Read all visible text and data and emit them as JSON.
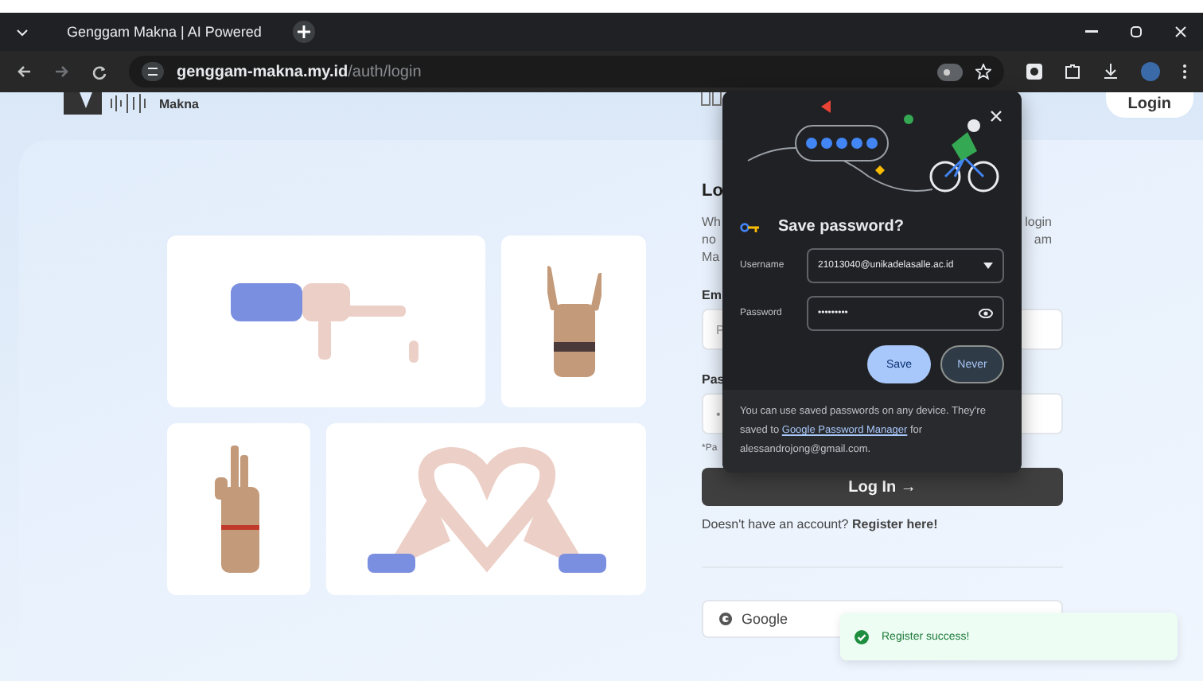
{
  "browser": {
    "tab": {
      "title": "Genggam Makna | AI Powered",
      "selected": true
    },
    "url_host": "genggam-makna.my.id",
    "url_path": "/auth/login"
  },
  "header": {
    "brand": "Makna",
    "login_button": "Login"
  },
  "gallery": [
    {
      "kind": "frame"
    },
    {
      "kind": "horns"
    },
    {
      "kind": "peace"
    },
    {
      "kind": "heart"
    }
  ],
  "form": {
    "title": "Lo",
    "description_left": [
      "Wh",
      "no",
      "Ma"
    ],
    "description_right": [
      "login",
      "am"
    ],
    "email_label": "Em",
    "email_placeholder": "P",
    "password_label": "Pas",
    "password_value": "•",
    "hint": "*Pa",
    "login_button": "Log In →",
    "register_prompt": "Doesn't have an account? **Register here!**",
    "google_button": "Google"
  },
  "password_dialog": {
    "title": "Save password?",
    "username_label": "Username",
    "username": "21013040@unikadelasalle.ac.id",
    "password_label": "Password",
    "password": "•••••••••",
    "save_button": "Save",
    "never_button": "Never",
    "footer_before": "You can use saved passwords on any device. They're saved to ",
    "footer_link": "Google Password Manager",
    "footer_after": " for alessandrojong@gmail.com."
  },
  "toast": {
    "message": "Register success!"
  }
}
